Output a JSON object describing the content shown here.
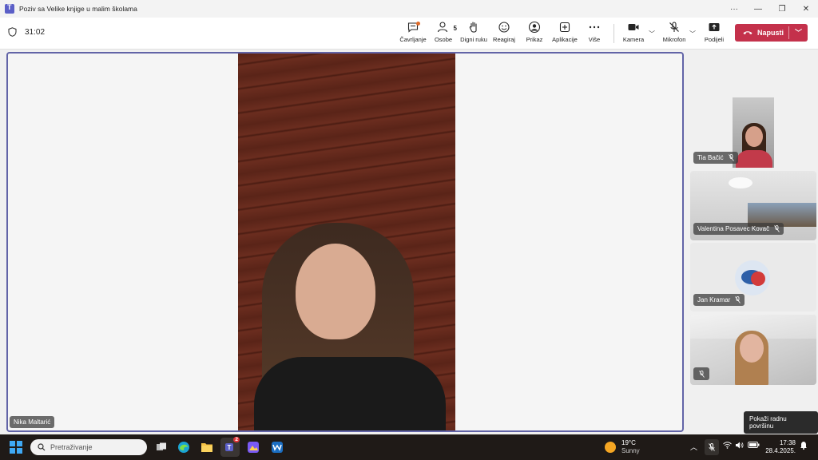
{
  "window": {
    "title": "Poziv sa Velike knjige u malim školama",
    "controls": [
      "more-icon",
      "minimize-icon",
      "restore-icon",
      "close-icon"
    ]
  },
  "meeting": {
    "timer": "31:02",
    "toolbar": {
      "chat": "Čavrljanje",
      "people": "Osobe",
      "people_count": "5",
      "raise_hand": "Digni ruku",
      "react": "Reagiraj",
      "view": "Prikaz",
      "apps": "Aplikacije",
      "more": "Više",
      "camera": "Kamera",
      "mic": "Mikrofon",
      "share": "Podijeli",
      "leave": "Napusti"
    },
    "colors": {
      "accent": "#6264a7",
      "leave": "#c4314b"
    }
  },
  "participants": {
    "main": {
      "name": "Nika Maltarić"
    },
    "side": [
      {
        "name": "Tia Bačić",
        "muted": true
      },
      {
        "name": "Valentina Posavec Kovač",
        "muted": true
      },
      {
        "name": "Jan Kramar",
        "muted": true
      },
      {
        "name": "",
        "muted": true
      }
    ]
  },
  "tooltip": "Pokaži radnu površinu",
  "taskbar": {
    "search_placeholder": "Pretraživanje",
    "teams_badge": "2",
    "weather": {
      "temp": "19°C",
      "condition": "Sunny"
    },
    "time": "17:38",
    "date": "28.4.2025."
  }
}
